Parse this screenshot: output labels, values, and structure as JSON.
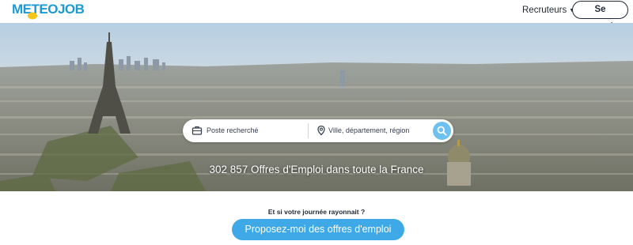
{
  "header": {
    "logo_text": "METEOJOB",
    "recruiters_label": "Recruteurs",
    "login_label": "Se connecter"
  },
  "search": {
    "job_placeholder": "Poste recherché",
    "location_placeholder": "Ville, département, région"
  },
  "hero": {
    "headline": "302 857 Offres d'Emploi dans toute la France"
  },
  "promo": {
    "tagline": "Et si votre journée rayonnait ?",
    "cta_label": "Proposez-moi des offres d'emploi"
  },
  "icons": {
    "logo_sun": "sun-icon",
    "recruiters_caret": "caret-down-icon",
    "job_field": "briefcase-icon",
    "location_field": "map-pin-icon",
    "search_button": "search-icon"
  },
  "colors": {
    "brand_blue": "#1c9ad6",
    "logo_sun": "#f5c518",
    "search_button": "#6cc1ee",
    "cta_background": "#3fa9e8",
    "text_dark": "#1f2937"
  }
}
